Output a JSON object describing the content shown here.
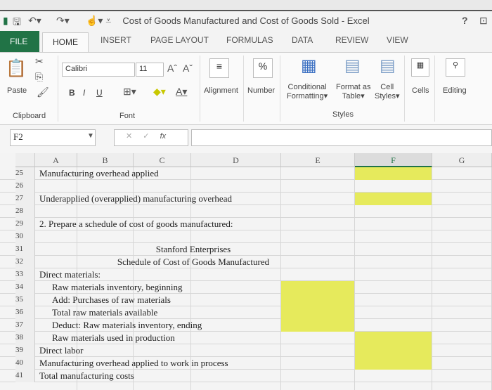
{
  "window": {
    "title": "Cost of Goods Manufactured and Cost of Goods Sold - Excel",
    "help": "?"
  },
  "tabs": [
    "FILE",
    "HOME",
    "INSERT",
    "PAGE LAYOUT",
    "FORMULAS",
    "DATA",
    "REVIEW",
    "VIEW"
  ],
  "ribbon": {
    "paste": "Paste",
    "font_name": "Calibri",
    "font_size": "11",
    "bold": "B",
    "italic": "I",
    "underline": "U",
    "alignment": "Alignment",
    "number": "Number",
    "percent": "%",
    "conditional_formatting": [
      "Conditional",
      "Formatting"
    ],
    "format_as_table": [
      "Format as",
      "Table"
    ],
    "cell_styles": [
      "Cell",
      "Styles"
    ],
    "cells": "Cells",
    "editing": "Editing",
    "groups": {
      "clipboard": "Clipboard",
      "font": "Font",
      "styles": "Styles"
    }
  },
  "formula_bar": {
    "name_box": "F2",
    "fx": "fx",
    "value": ""
  },
  "columns": [
    "A",
    "B",
    "C",
    "D",
    "E",
    "F",
    "G"
  ],
  "rows": [
    {
      "n": "25",
      "text": "Manufacturing overhead applied",
      "indent": 0,
      "yellow": [
        "F"
      ]
    },
    {
      "n": "26",
      "text": "",
      "indent": 0,
      "yellow": []
    },
    {
      "n": "27",
      "text": "Underapplied (overapplied) manufacturing overhead",
      "indent": 0,
      "yellow": [
        "F"
      ]
    },
    {
      "n": "28",
      "text": "",
      "indent": 0,
      "yellow": []
    },
    {
      "n": "29",
      "text": "2. Prepare a schedule of cost of goods manufactured:",
      "indent": 0,
      "yellow": []
    },
    {
      "n": "30",
      "text": "",
      "indent": 0,
      "yellow": []
    },
    {
      "n": "31",
      "text": "Stanford Enterprises",
      "center": true,
      "yellow": []
    },
    {
      "n": "32",
      "text": "Schedule of Cost of Goods Manufactured",
      "center": true,
      "yellow": []
    },
    {
      "n": "33",
      "text": "Direct materials:",
      "indent": 0,
      "yellow": []
    },
    {
      "n": "34",
      "text": "Raw materials inventory, beginning",
      "indent": 1,
      "yellow": [
        "E"
      ]
    },
    {
      "n": "35",
      "text": "Add: Purchases of raw materials",
      "indent": 1,
      "yellow": [
        "E"
      ]
    },
    {
      "n": "36",
      "text": "Total raw materials available",
      "indent": 1,
      "yellow": [
        "E"
      ]
    },
    {
      "n": "37",
      "text": "Deduct: Raw materials inventory, ending",
      "indent": 1,
      "yellow": [
        "E"
      ]
    },
    {
      "n": "38",
      "text": "Raw materials used in production",
      "indent": 1,
      "yellow": [
        "F"
      ]
    },
    {
      "n": "39",
      "text": "Direct labor",
      "indent": 0,
      "yellow": [
        "F"
      ]
    },
    {
      "n": "40",
      "text": "Manufacturing overhead applied to work in process",
      "indent": 0,
      "yellow": [
        "F"
      ]
    },
    {
      "n": "41",
      "text": "Total manufacturing costs",
      "indent": 0,
      "yellow": []
    }
  ],
  "colors": {
    "file_tab": "#217346",
    "input_highlight": "#e6ea5c"
  }
}
